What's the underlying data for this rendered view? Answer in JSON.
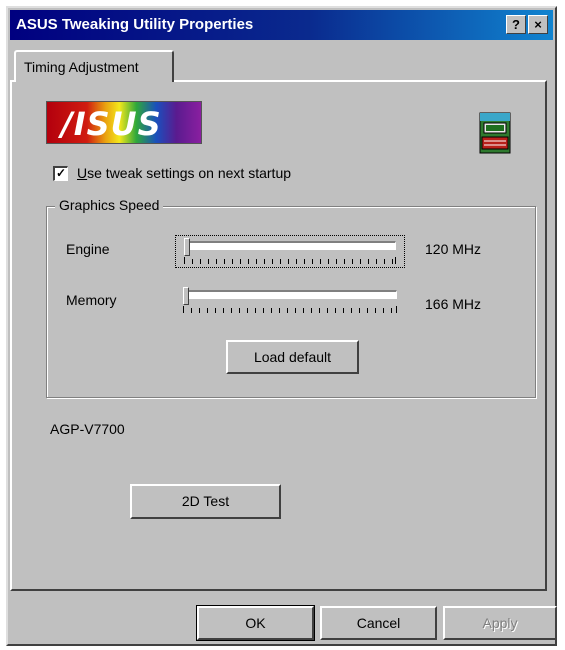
{
  "window": {
    "title": "ASUS Tweaking Utility Properties",
    "help_button": "?",
    "close_button": "×"
  },
  "tabs": [
    {
      "label": "Timing Adjustment",
      "selected": true
    }
  ],
  "branding": {
    "logo_text": "/ISUS",
    "logo_icon": "asus-rainbow-logo",
    "chip_icon": "graphics-chip-icon"
  },
  "startup_option": {
    "checked": true,
    "label_accel": "U",
    "label_rest": "se tweak settings on next startup"
  },
  "graphics_speed": {
    "group_label": "Graphics Speed",
    "engine": {
      "label": "Engine",
      "value_text": "120 MHz",
      "slider_fraction": 0.0
    },
    "memory": {
      "label": "Memory",
      "value_text": "166 MHz",
      "slider_fraction": 0.0
    },
    "load_default_label": "Load default"
  },
  "model_name": "AGP-V7700",
  "test_button_label": "2D Test",
  "footer": {
    "ok_label": "OK",
    "cancel_label": "Cancel",
    "apply_label": "Apply",
    "apply_enabled": false
  }
}
